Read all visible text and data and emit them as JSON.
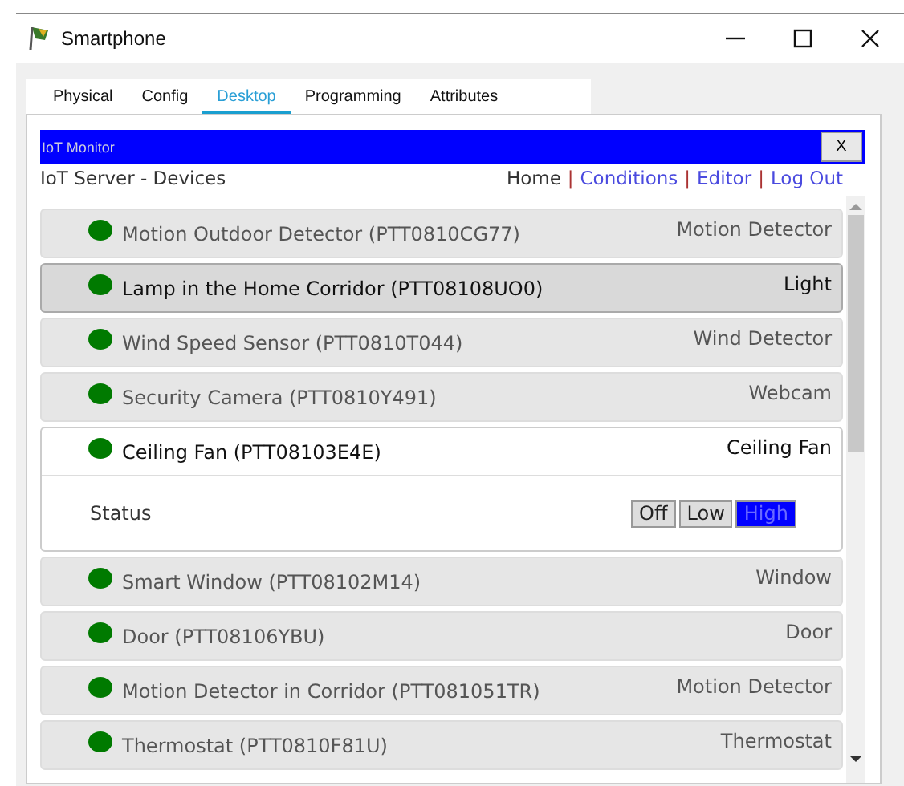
{
  "window": {
    "title": "Smartphone"
  },
  "tabs": [
    {
      "label": "Physical",
      "selected": false
    },
    {
      "label": "Config",
      "selected": false
    },
    {
      "label": "Desktop",
      "selected": true
    },
    {
      "label": "Programming",
      "selected": false
    },
    {
      "label": "Attributes",
      "selected": false
    }
  ],
  "app": {
    "title": "IoT Monitor",
    "close": "X"
  },
  "header": {
    "title": "IoT Server - Devices",
    "links": [
      {
        "label": "Home",
        "kind": "current"
      },
      {
        "label": "Conditions",
        "kind": "link"
      },
      {
        "label": "Editor",
        "kind": "link"
      },
      {
        "label": "Log Out",
        "kind": "link"
      }
    ],
    "separator": "|"
  },
  "devices": [
    {
      "name": "Motion Outdoor Detector (PTT0810CG77)",
      "type": "Motion Detector",
      "selected": false,
      "expanded": false
    },
    {
      "name": "Lamp in the Home Corridor (PTT08108UO0)",
      "type": "Light",
      "selected": true,
      "expanded": false
    },
    {
      "name": "Wind Speed Sensor (PTT0810T044)",
      "type": "Wind Detector",
      "selected": false,
      "expanded": false
    },
    {
      "name": "Security Camera (PTT0810Y491)",
      "type": "Webcam",
      "selected": false,
      "expanded": false
    },
    {
      "name": "Ceiling Fan (PTT08103E4E)",
      "type": "Ceiling Fan",
      "selected": false,
      "expanded": true,
      "detail": {
        "label": "Status",
        "options": [
          {
            "label": "Off",
            "selected": false
          },
          {
            "label": "Low",
            "selected": false
          },
          {
            "label": "High",
            "selected": true
          }
        ]
      }
    },
    {
      "name": "Smart Window (PTT08102M14)",
      "type": "Window",
      "selected": false,
      "expanded": false
    },
    {
      "name": "Door (PTT08106YBU)",
      "type": "Door",
      "selected": false,
      "expanded": false
    },
    {
      "name": "Motion Detector in Corridor (PTT081051TR)",
      "type": "Motion Detector",
      "selected": false,
      "expanded": false
    },
    {
      "name": "Thermostat (PTT0810F81U)",
      "type": "Thermostat",
      "selected": false,
      "expanded": false
    }
  ]
}
